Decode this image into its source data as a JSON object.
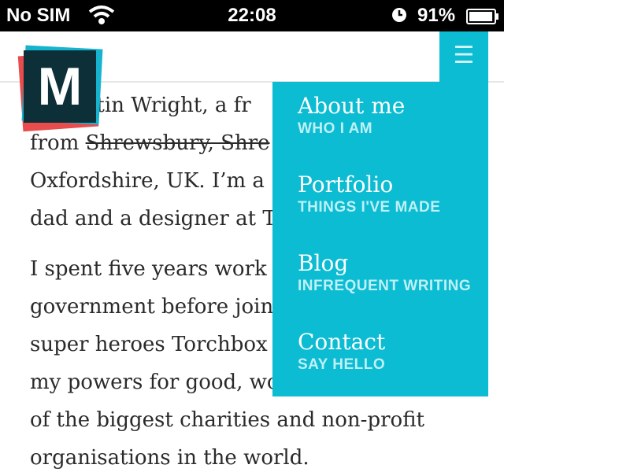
{
  "status_bar": {
    "carrier": "No SIM",
    "time": "22:08",
    "battery": "91%",
    "battery_level": 0.91,
    "icons": [
      "wifi-icon",
      "alarm-icon",
      "battery-icon"
    ]
  },
  "logo": {
    "letter": "M"
  },
  "menu": {
    "toggle_icon": "☰"
  },
  "content": {
    "p1": {
      "l1": "rtin Wright, a fr",
      "l2_a": "from ",
      "l2_strike": "Shrewsbury, Shre",
      "l3": "Oxfordshire, UK. I’m a",
      "l4": "dad and a designer at T"
    },
    "p2": {
      "l1": "I spent five years work",
      "l2": "government before join",
      "l3": "super heroes Torchbox",
      "l4": "my powers for good, working with some",
      "l5": "of the biggest charities and non-profit",
      "l6": "organisations in the world."
    }
  },
  "nav": {
    "items": [
      {
        "label": "About me",
        "subtitle": "WHO I AM"
      },
      {
        "label": "Portfolio",
        "subtitle": "THINGS I'VE MADE"
      },
      {
        "label": "Blog",
        "subtitle": "INFREQUENT WRITING"
      },
      {
        "label": "Contact",
        "subtitle": "SAY HELLO"
      }
    ]
  },
  "colors": {
    "menu_bg": "#0bbcd2",
    "logo_dark": "#0d2f38",
    "logo_red": "#e84c4c",
    "logo_blue": "#16b3cf",
    "text": "#2a2a2a"
  }
}
